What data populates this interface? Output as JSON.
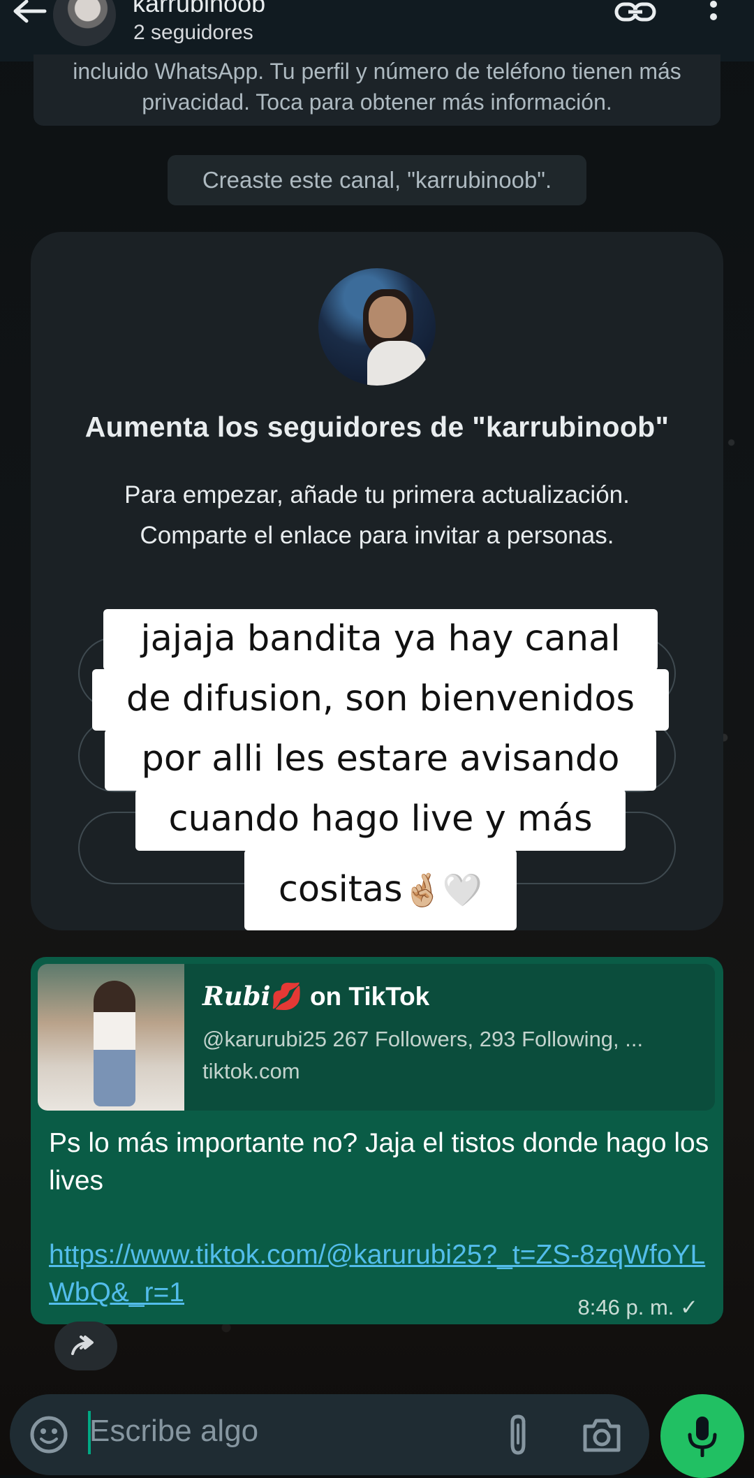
{
  "header": {
    "title": "karrubinoob",
    "subtitle": "2 seguidores"
  },
  "notice": {
    "text": "incluido WhatsApp. Tu perfil y número de teléfono tienen más privacidad. Toca para obtener más información."
  },
  "created_chip": "Creaste este canal, \"karrubinoob\".",
  "card": {
    "title": "Aumenta los seguidores de \"karrubinoob\"",
    "body": "Para empezar, añade tu primera actualización. Comparte el enlace para invitar a personas."
  },
  "overlay": {
    "lines": [
      "jajaja bandita ya hay canal",
      "de difusion, son bienvenidos",
      "por alli les estare avisando",
      "cuando hago live y más",
      "cositas"
    ],
    "emoji": "🤞🏼🤍"
  },
  "message": {
    "preview_name": "Rubi",
    "preview_name_emoji": "💋",
    "preview_title_suffix": "on TikTok",
    "preview_desc": "@karurubi25 267 Followers, 293 Following, ...",
    "preview_domain": "tiktok.com",
    "text": "Ps lo más importante no? Jaja el tistos donde hago los lives",
    "link": "https://www.tiktok.com/@karurubi25?_t=ZS-8zqWfoYLWbQ&_r=1",
    "time": "8:46 p. m.",
    "status": "✓"
  },
  "composer": {
    "placeholder": "Escribe algo"
  },
  "colors": {
    "accent": "#21c063",
    "bubble": "#0a5c46",
    "link": "#53bdeb"
  },
  "icons": [
    "back-arrow-icon",
    "link-icon",
    "more-vert-icon",
    "forward-icon",
    "emoji-icon",
    "attach-icon",
    "camera-icon",
    "mic-icon"
  ]
}
